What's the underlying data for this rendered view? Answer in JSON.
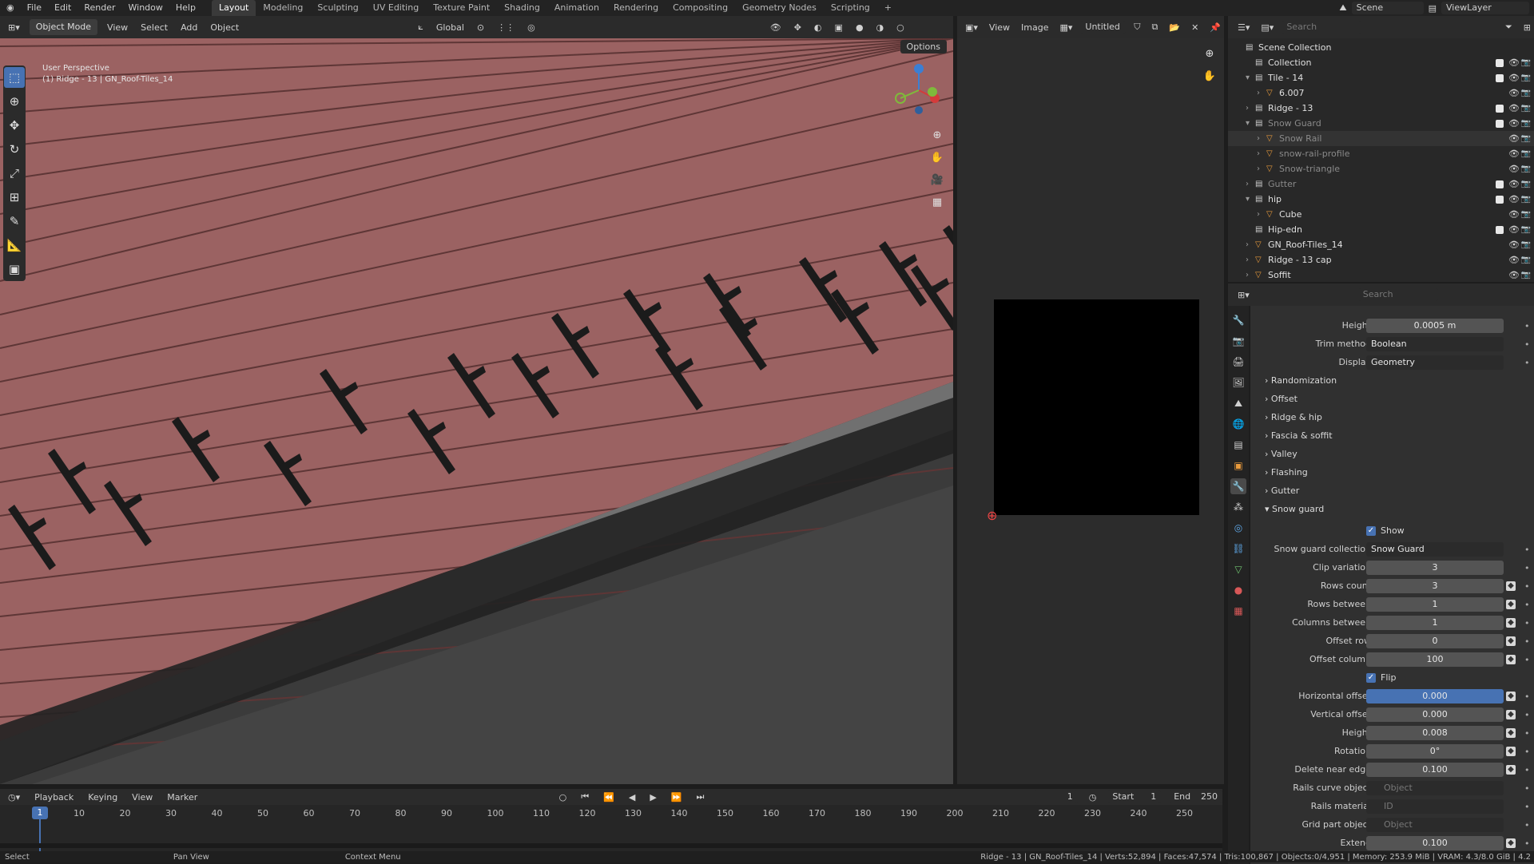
{
  "menus": [
    "File",
    "Edit",
    "Render",
    "Window",
    "Help"
  ],
  "workspaces": [
    "Layout",
    "Modeling",
    "Sculpting",
    "UV Editing",
    "Texture Paint",
    "Shading",
    "Animation",
    "Rendering",
    "Compositing",
    "Geometry Nodes",
    "Scripting",
    "+"
  ],
  "scene": "Scene",
  "view_layer": "ViewLayer",
  "viewport": {
    "mode": "Object Mode",
    "menus": [
      "View",
      "Select",
      "Add",
      "Object"
    ],
    "orientation": "Global",
    "options": "Options",
    "view_label": "User Perspective",
    "object_label": "(1) Ridge - 13 | GN_Roof-Tiles_14"
  },
  "image_editor": {
    "menus": [
      "View",
      "Image"
    ],
    "image_name": "Untitled"
  },
  "outliner": {
    "search_placeholder": "Search",
    "rows": [
      {
        "name": "Scene Collection",
        "dim": false
      },
      {
        "name": "Collection",
        "dim": false
      },
      {
        "name": "Tile - 14",
        "dim": false
      },
      {
        "name": "6.007",
        "dim": false
      },
      {
        "name": "Ridge - 13",
        "dim": false
      },
      {
        "name": "Snow Guard",
        "dim": true
      },
      {
        "name": "Snow Rail",
        "dim": true
      },
      {
        "name": "snow-rail-profile",
        "dim": true
      },
      {
        "name": "Snow-triangle",
        "dim": true
      },
      {
        "name": "Gutter",
        "dim": true
      },
      {
        "name": "hip",
        "dim": false
      },
      {
        "name": "Cube",
        "dim": false
      },
      {
        "name": "Hip-edn",
        "dim": false
      },
      {
        "name": "GN_Roof-Tiles_14",
        "dim": false
      },
      {
        "name": "Ridge - 13 cap",
        "dim": false
      },
      {
        "name": "Soffit",
        "dim": false
      }
    ]
  },
  "properties": {
    "search_placeholder": "Search",
    "height_top": {
      "label": "Height",
      "value": "0.0005 m"
    },
    "trim_method": {
      "label": "Trim method",
      "value": "Boolean"
    },
    "display": {
      "label": "Display",
      "value": "Geometry"
    },
    "sections": [
      "Randomization",
      "Offset",
      "Ridge & hip",
      "Fascia & soffit",
      "Valley",
      "Flashing",
      "Gutter",
      "Snow guard"
    ],
    "show": "Show",
    "flip": "Flip",
    "fields": [
      {
        "label": "Snow guard collection",
        "value": "Snow Guard"
      },
      {
        "label": "Clip variation",
        "value": "3"
      },
      {
        "label": "Rows count",
        "value": "3"
      },
      {
        "label": "Rows between",
        "value": "1"
      },
      {
        "label": "Columns between",
        "value": "1"
      },
      {
        "label": "Offset row",
        "value": "0"
      },
      {
        "label": "Offset column",
        "value": "100"
      },
      {
        "label": "Horizontal offset",
        "value": "0.000"
      },
      {
        "label": "Vertical offset",
        "value": "0.000"
      },
      {
        "label": "Height",
        "value": "0.008"
      },
      {
        "label": "Rotation",
        "value": "0°"
      },
      {
        "label": "Delete near edge",
        "value": "0.100"
      },
      {
        "label": "Rails curve object",
        "value": "Object"
      },
      {
        "label": "Rails material",
        "value": "ID"
      },
      {
        "label": "Grid part object",
        "value": "Object"
      },
      {
        "label": "Extend",
        "value": "0.100"
      }
    ]
  },
  "timeline": {
    "menus": [
      "Playback",
      "Keying",
      "View",
      "Marker"
    ],
    "current_frame": "1",
    "start_label": "Start",
    "start": "1",
    "end_label": "End",
    "end": "250",
    "playhead": "1",
    "ticks": [
      "10",
      "20",
      "30",
      "40",
      "50",
      "60",
      "70",
      "80",
      "90",
      "100",
      "110",
      "120",
      "130",
      "140",
      "150",
      "160",
      "170",
      "180",
      "190",
      "200",
      "210",
      "220",
      "230",
      "240",
      "250"
    ]
  },
  "status": {
    "select": "Select",
    "pan": "Pan View",
    "context": "Context Menu",
    "info": "Ridge - 13 | GN_Roof-Tiles_14 | Verts:52,894 | Faces:47,574 | Tris:100,867 | Objects:0/4,951 | Memory: 253.9 MiB | VRAM: 4.3/8.0 GiB | 4.2"
  },
  "colors": {
    "accent": "#4772b3",
    "roof": "#9a6060",
    "gutter": "#262626"
  }
}
